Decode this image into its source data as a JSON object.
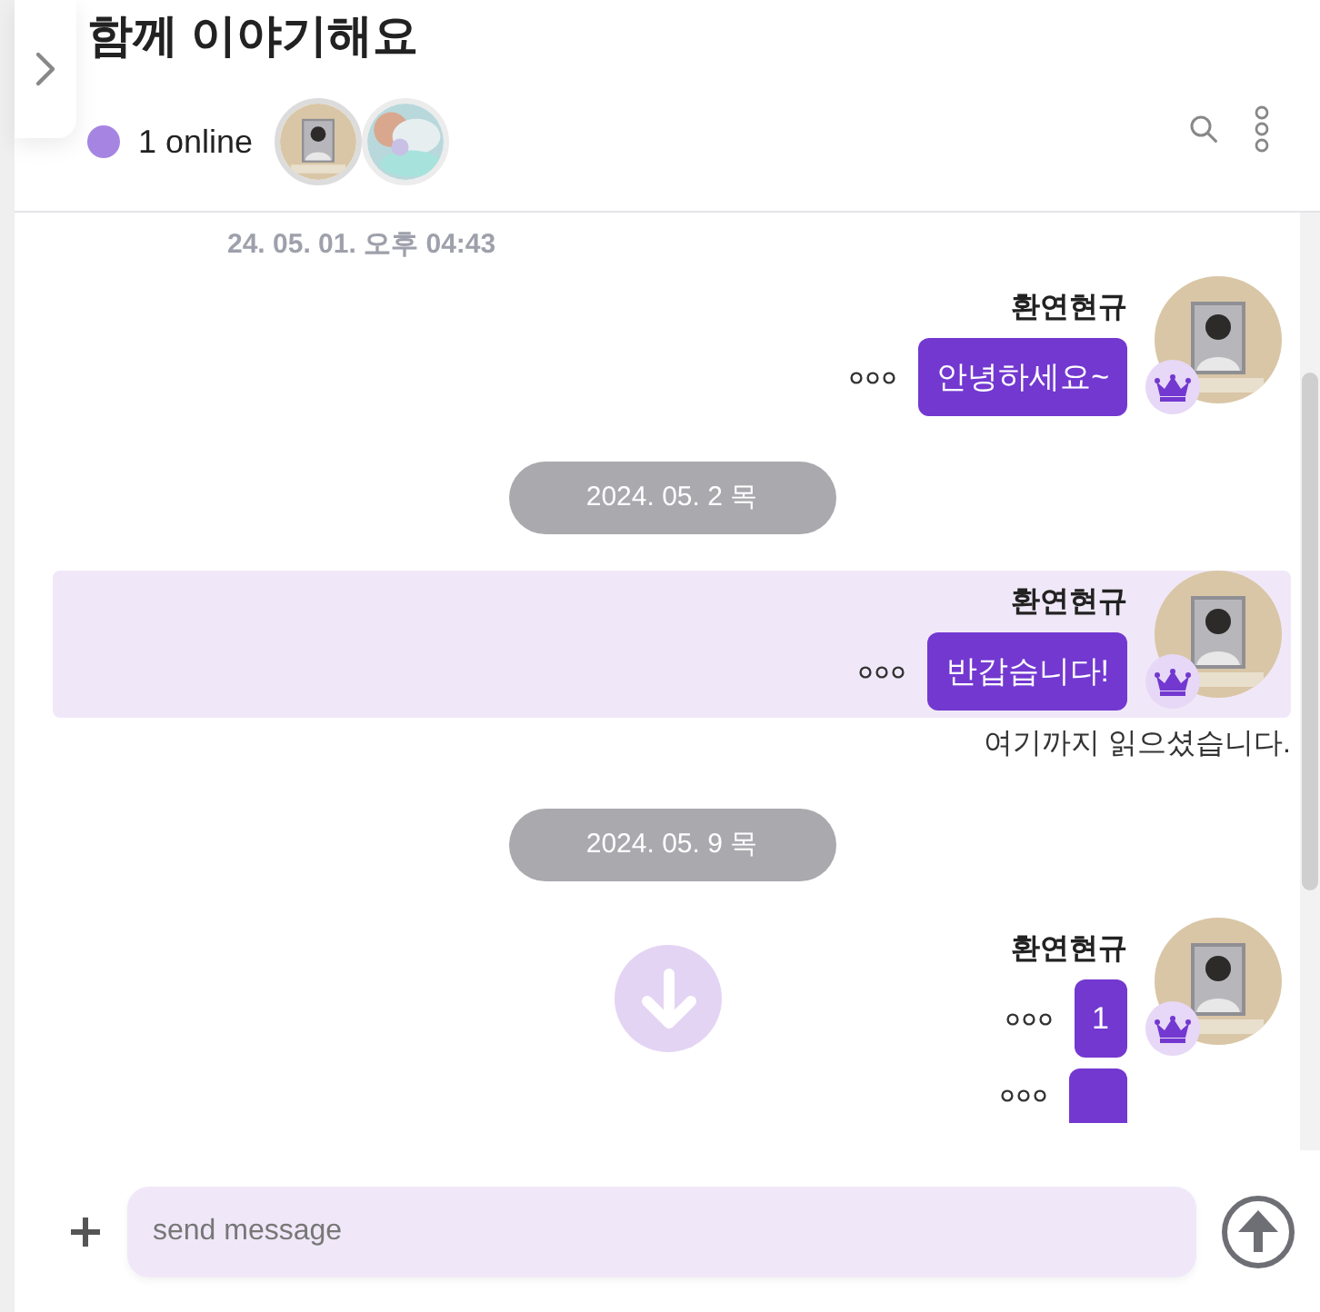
{
  "header": {
    "title": "함께 이야기해요",
    "online": "1 online"
  },
  "feed": [
    {
      "kind": "timestamp",
      "text": "24. 05. 01. 오후 04:43"
    },
    {
      "kind": "message",
      "sender": "환연현규",
      "crown": true,
      "highlighted": false,
      "bubbles": [
        {
          "text": "안녕하세요~"
        }
      ]
    },
    {
      "kind": "date",
      "text": "2024. 05. 2 목"
    },
    {
      "kind": "message",
      "sender": "환연현규",
      "crown": true,
      "highlighted": true,
      "bubbles": [
        {
          "text": "반갑습니다!"
        }
      ]
    },
    {
      "kind": "read_marker",
      "text": "여기까지 읽으셨습니다."
    },
    {
      "kind": "date",
      "text": "2024. 05. 9 목"
    },
    {
      "kind": "message",
      "sender": "환연현규",
      "crown": true,
      "highlighted": false,
      "bubbles": [
        {
          "text": "1"
        },
        {
          "kind": "clipped"
        }
      ]
    }
  ],
  "composer": {
    "placeholder": "send message"
  }
}
